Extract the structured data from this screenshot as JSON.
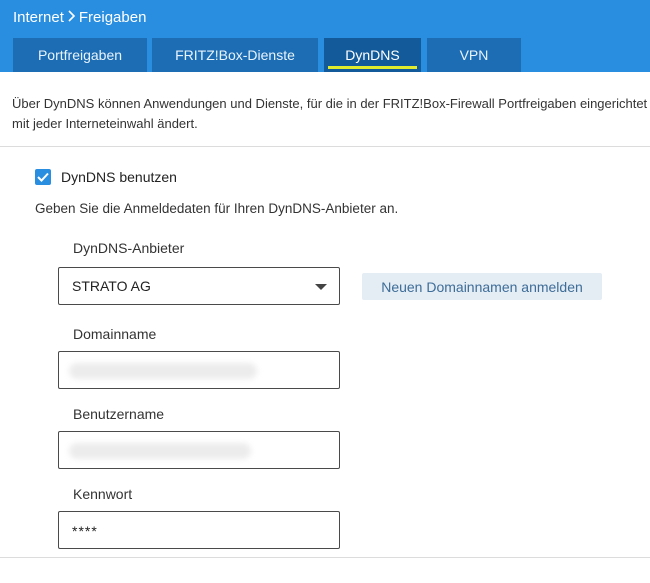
{
  "breadcrumb": {
    "parent": "Internet",
    "current": "Freigaben"
  },
  "tabs": [
    {
      "label": "Portfreigaben"
    },
    {
      "label": "FRITZ!Box-Dienste"
    },
    {
      "label": "DynDNS"
    },
    {
      "label": "VPN"
    }
  ],
  "active_tab": "DynDNS",
  "intro": {
    "line1": "Über DynDNS können Anwendungen und Dienste, für die in der FRITZ!Box-Firewall Portfreigaben eingerichtet wurden, auch dann erreicht werden, wenn sich die IP-Adresse",
    "line2": "mit jeder Interneteinwahl ändert."
  },
  "dyndns": {
    "checkbox_label": "DynDNS benutzen",
    "checked": true,
    "hint": "Geben Sie die Anmeldedaten für Ihren DynDNS-Anbieter an.",
    "provider_label": "DynDNS-Anbieter",
    "provider_value": "STRATO AG",
    "register_button": "Neuen Domainnamen anmelden",
    "domain_label": "Domainname",
    "username_label": "Benutzername",
    "password_label": "Kennwort",
    "password_value": "****"
  },
  "colors": {
    "header_bg": "#2a8ee0",
    "tab_bg": "#1c6db4",
    "tab_active_bg": "#135a9a",
    "tab_active_underline": "#e2ec2e",
    "button_bg": "#e4ecf4",
    "button_text": "#3d6d98"
  }
}
